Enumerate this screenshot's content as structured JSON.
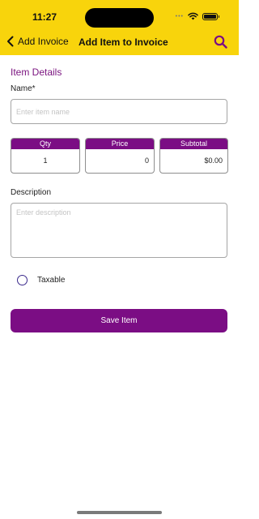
{
  "status_bar": {
    "time": "11:27",
    "signal_dots": "•••"
  },
  "nav": {
    "back_label": "Add Invoice",
    "title": "Add Item to Invoice",
    "back_icon": "chevron-left-icon",
    "search_icon": "search-icon"
  },
  "form": {
    "section_title": "Item Details",
    "name_label": "Name*",
    "name_placeholder": "Enter item name",
    "name_value": "",
    "columns": {
      "qty": {
        "header": "Qty",
        "value": "1"
      },
      "price": {
        "header": "Price",
        "value": "0"
      },
      "subtotal": {
        "header": "Subtotal",
        "value": "$0.00"
      }
    },
    "description_label": "Description",
    "description_placeholder": "Enter description",
    "taxable_label": "Taxable",
    "taxable_checked": false,
    "save_label": "Save Item"
  },
  "colors": {
    "header_bg": "#f8d40c",
    "accent": "#7b0d84",
    "section_title": "#7b1580"
  }
}
